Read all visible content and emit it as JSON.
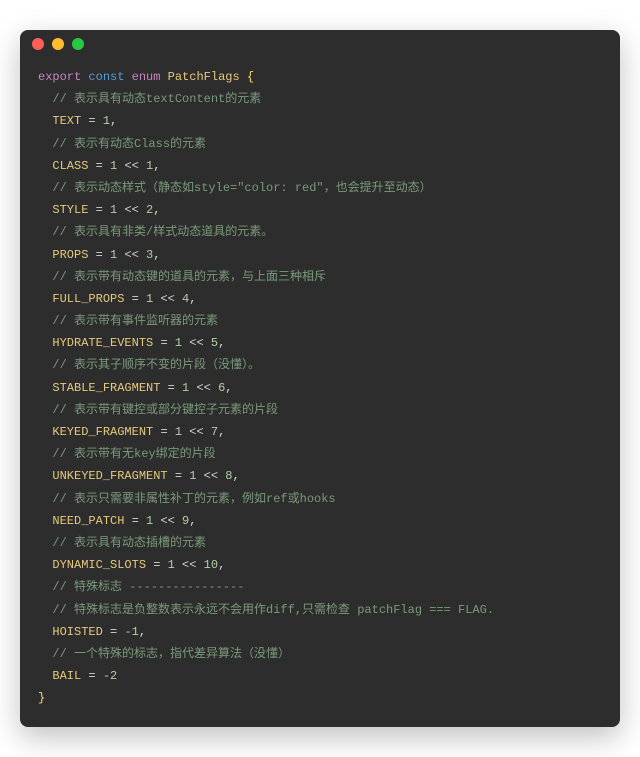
{
  "window": {
    "dots": [
      "close",
      "minimize",
      "maximize"
    ]
  },
  "code": {
    "decl": {
      "export": "export",
      "const": "const",
      "enum": "enum",
      "name": "PatchFlags",
      "open": "{",
      "close": "}"
    },
    "entries": [
      {
        "comment": "// 表示具有动态textContent的元素",
        "name": "TEXT",
        "expr": "1"
      },
      {
        "comment": "// 表示有动态Class的元素",
        "name": "CLASS",
        "expr": "1 << 1"
      },
      {
        "comment": "// 表示动态样式（静态如style=\"color: red\"，也会提升至动态）",
        "name": "STYLE",
        "expr": "1 << 2"
      },
      {
        "comment": "// 表示具有非类/样式动态道具的元素。",
        "name": "PROPS",
        "expr": "1 << 3"
      },
      {
        "comment": "// 表示带有动态键的道具的元素，与上面三种相斥",
        "name": "FULL_PROPS",
        "expr": "1 << 4"
      },
      {
        "comment": "// 表示带有事件监听器的元素",
        "name": "HYDRATE_EVENTS",
        "expr": "1 << 5"
      },
      {
        "comment": "// 表示其子顺序不变的片段（没懂）。",
        "name": "STABLE_FRAGMENT",
        "expr": "1 << 6"
      },
      {
        "comment": "// 表示带有键控或部分键控子元素的片段",
        "name": "KEYED_FRAGMENT",
        "expr": "1 << 7"
      },
      {
        "comment": "// 表示带有无key绑定的片段",
        "name": "UNKEYED_FRAGMENT",
        "expr": "1 << 8"
      },
      {
        "comment": "// 表示只需要非属性补丁的元素，例如ref或hooks",
        "name": "NEED_PATCH",
        "expr": "1 << 9"
      },
      {
        "comment": "// 表示具有动态插槽的元素",
        "name": "DYNAMIC_SLOTS",
        "expr": "1 << 10"
      },
      {
        "comment": "// 特殊标志 ----------------",
        "extraComment": "// 特殊标志是负整数表示永远不会用作diff,只需检查 patchFlag === FLAG.",
        "name": "HOISTED",
        "expr": "-1"
      },
      {
        "comment": "// 一个特殊的标志，指代差异算法（没懂）",
        "name": "BAIL",
        "expr": "-2",
        "last": true
      }
    ]
  }
}
